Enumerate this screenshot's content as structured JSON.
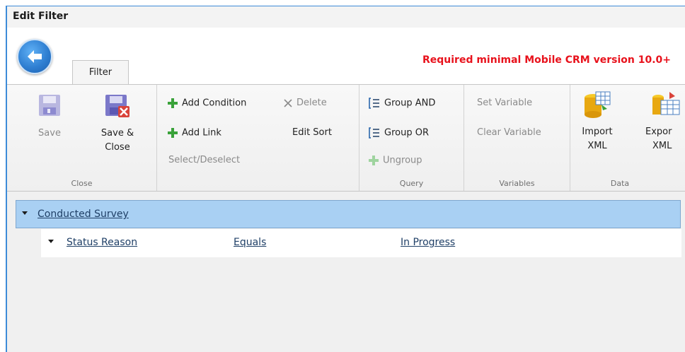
{
  "window": {
    "title": "Edit Filter"
  },
  "header": {
    "tab_label": "Filter",
    "requirement_text": "Required minimal Mobile CRM version 10.0+"
  },
  "ribbon": {
    "close_group": {
      "label": "Close",
      "save": "Save",
      "save_close_1": "Save &",
      "save_close_2": "Close"
    },
    "edit_group": {
      "add_condition": "Add Condition",
      "delete": "Delete",
      "add_link": "Add Link",
      "edit_sort": "Edit Sort",
      "select_deselect": "Select/Deselect"
    },
    "query_group": {
      "label": "Query",
      "group_and": "Group AND",
      "group_or": "Group OR",
      "ungroup": "Ungroup"
    },
    "variables_group": {
      "label": "Variables",
      "set_variable": "Set Variable",
      "clear_variable": "Clear Variable"
    },
    "data_group": {
      "label": "Data",
      "import_1": "Import",
      "import_2": "XML",
      "export_1": "Expor",
      "export_2": "XML"
    }
  },
  "tree": {
    "entity": "Conducted Survey",
    "conditions": [
      {
        "field": "Status Reason",
        "operator": "Equals",
        "value": "In Progress"
      }
    ]
  },
  "colors": {
    "accent_red": "#e8121c",
    "selection_blue": "#a9d0f3",
    "window_border": "#3d8bd8",
    "plus_green": "#3aa23a"
  }
}
